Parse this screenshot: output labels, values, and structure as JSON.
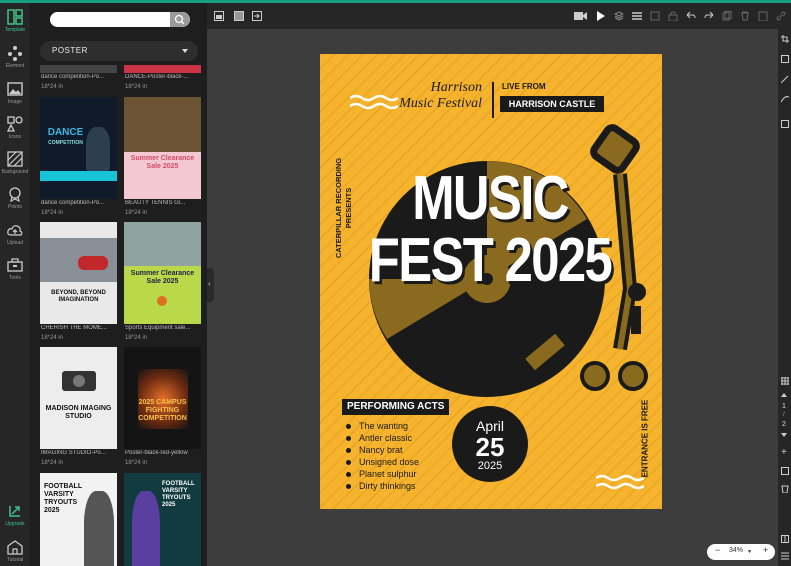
{
  "rail": {
    "items": [
      {
        "key": "template",
        "label": "Template"
      },
      {
        "key": "element",
        "label": "Element"
      },
      {
        "key": "image",
        "label": "Image"
      },
      {
        "key": "icons",
        "label": "Icons"
      },
      {
        "key": "background",
        "label": "Background"
      },
      {
        "key": "points",
        "label": "Points"
      },
      {
        "key": "upload",
        "label": "Upload"
      },
      {
        "key": "tools",
        "label": "Tools"
      },
      {
        "key": "upgrade",
        "label": "Upgrade"
      },
      {
        "key": "tutorial",
        "label": "Tutorial"
      }
    ]
  },
  "panel": {
    "category": "POSTER",
    "top_captions": [
      "dance competition-Po...",
      "DANCE-Poster-black-..."
    ],
    "top_sizes": [
      "18*24 in",
      "18*24 in"
    ],
    "templates": [
      {
        "caption": "dance competition-Po...",
        "size": "18*24 in",
        "title": "DANCE",
        "sub": "COMPETITION"
      },
      {
        "caption": "BEAUTY TENNIS Gl...",
        "size": "18*24 in",
        "title": "Summer Clearance Sale 2025",
        "sub": ""
      },
      {
        "caption": "CHERISH THE MOME...",
        "size": "18*24 in",
        "title": "BEYOND, BEYOND IMAGINATION",
        "sub": ""
      },
      {
        "caption": "Sports Equipment sale...",
        "size": "18*24 in",
        "title": "Summer Clearance Sale 2025",
        "sub": ""
      },
      {
        "caption": "IMAGING STUDIO-Po...",
        "size": "18*24 in",
        "title": "MADISON IMAGING STUDIO",
        "sub": ""
      },
      {
        "caption": "Poster-black-red-yellow",
        "size": "18*24 in",
        "title": "2025 CAMPUS FIGHTING COMPETITION",
        "sub": ""
      },
      {
        "caption": "",
        "size": "",
        "title": "FOOTBALL VARSITY TRYOUTS 2025",
        "sub": ""
      },
      {
        "caption": "",
        "size": "",
        "title": "FOOTBALL VARSITY TRYOUTS 2025",
        "sub": ""
      }
    ]
  },
  "poster": {
    "festival_line1": "Harrison",
    "festival_line2": "Music Festival",
    "live_from": "LIVE FROM",
    "venue": "HARRISON CASTLE",
    "presenter_line1": "CATERPILLAR RECORDING",
    "presenter_line2": "PRESENTS",
    "title_line1": "MUSIC",
    "title_line2": "FEST 2025",
    "acts_heading": "PERFORMING ACTS",
    "acts": [
      "The wanting",
      "Antler classic",
      "Nancy brat",
      "Unsigned dose",
      "Planet sulphur",
      "Dirty thinkings"
    ],
    "date_month": "April",
    "date_day": "25",
    "date_year": "2025",
    "entrance": "ENTRANCE IS FREE"
  },
  "pager": {
    "current": "1",
    "total": "2"
  },
  "zoom": {
    "value": "34%",
    "minus": "−",
    "plus": "+"
  },
  "colors": {
    "accent": "#17a07e",
    "poster_bg": "#f6b42e",
    "record": "#1a1a1a",
    "tonearm": "#8a6a1e"
  }
}
